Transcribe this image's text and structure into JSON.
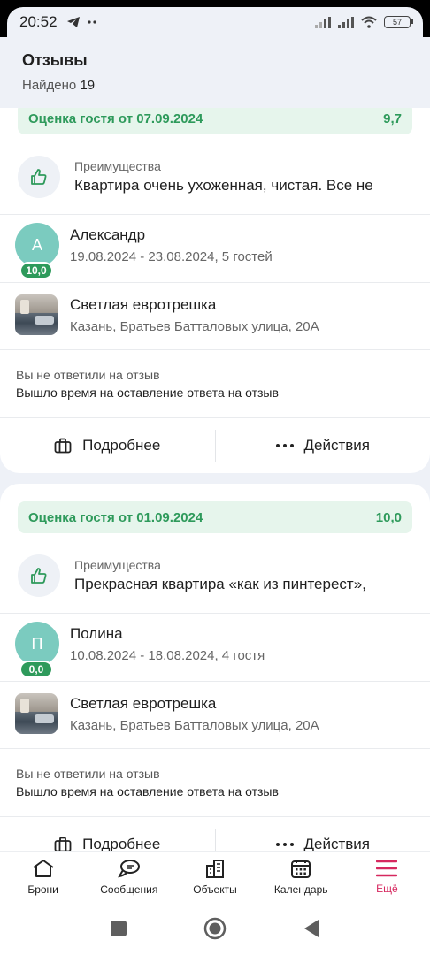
{
  "status": {
    "time": "20:52",
    "battery": "57"
  },
  "header": {
    "title": "Отзывы",
    "found_label": "Найдено",
    "found_count": "19"
  },
  "reviews": [
    {
      "rating_label": "Оценка гостя от 07.09.2024",
      "rating_value": "9,7",
      "pros_label": "Преимущества",
      "pros_text": "Квартира очень ухоженная, чистая. Все не",
      "guest_initial": "А",
      "guest_score": "10,0",
      "guest_name": "Александр",
      "guest_dates": "19.08.2024 - 23.08.2024, 5 гостей",
      "object_name": "Светлая евротрешка",
      "object_address": "Казань, Братьев Батталовых улица, 20А",
      "reply_status": "Вы не ответили на отзыв",
      "reply_note": "Вышло время на оставление ответа на отзыв",
      "details_label": "Подробнее",
      "actions_label": "Действия"
    },
    {
      "rating_label": "Оценка гостя от 01.09.2024",
      "rating_value": "10,0",
      "pros_label": "Преимущества",
      "pros_text": "Прекрасная квартира «как из пинтерест»,",
      "guest_initial": "П",
      "guest_score": "0,0",
      "guest_name": "Полина",
      "guest_dates": "10.08.2024 - 18.08.2024, 4 гостя",
      "object_name": "Светлая евротрешка",
      "object_address": "Казань, Братьев Батталовых улица, 20А",
      "reply_status": "Вы не ответили на отзыв",
      "reply_note": "Вышло время на оставление ответа на отзыв",
      "details_label": "Подробнее",
      "actions_label": "Действия"
    }
  ],
  "nav": {
    "items": [
      {
        "label": "Брони",
        "icon": "home-icon"
      },
      {
        "label": "Сообщения",
        "icon": "chat-icon"
      },
      {
        "label": "Объекты",
        "icon": "buildings-icon"
      },
      {
        "label": "Календарь",
        "icon": "calendar-icon"
      },
      {
        "label": "Ещё",
        "icon": "menu-icon"
      }
    ],
    "active_color": "#d6285f"
  },
  "colors": {
    "rating_green": "#2e9a5b",
    "rating_bg": "#e6f5ec",
    "avatar": "#7bcbbf"
  }
}
